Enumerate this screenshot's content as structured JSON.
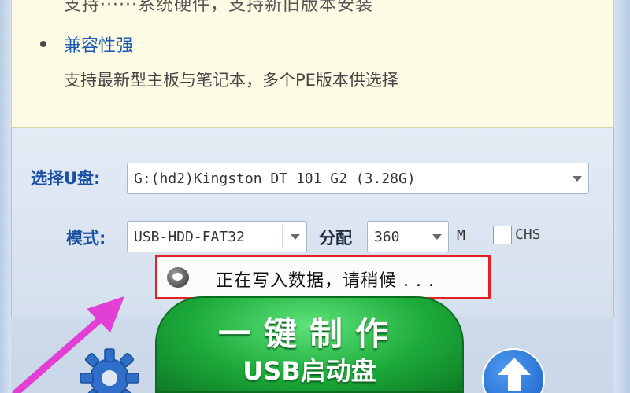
{
  "features": {
    "cut_line_text": "支持······系统硬件，支持新旧版本安装",
    "title": "兼容性强",
    "description": "支持最新型主板与笔记本，多个PE版本供选择"
  },
  "form": {
    "usb_label": "选择U盘:",
    "usb_value": "G:(hd2)Kingston DT 101 G2 (3.28G)",
    "mode_label": "模式:",
    "mode_value": "USB-HDD-FAT32",
    "alloc_label": "分配",
    "alloc_value": "360",
    "alloc_unit": "M",
    "chs_label": "CHS",
    "chs_checked": false
  },
  "status": {
    "text": "正在写入数据，请稍候 . . ."
  },
  "buttons": {
    "make_line1": "一键制作",
    "make_line2": "USB启动盘"
  },
  "colors": {
    "accent_blue": "#1a4fa3",
    "highlight_red": "#e22222",
    "make_button_green": "#1cab3a",
    "annotation_pink": "#e23fd4"
  },
  "icons": {
    "settings": "gear-icon",
    "upgrade": "arrow-up-icon",
    "status": "speech-bubble-icon"
  }
}
